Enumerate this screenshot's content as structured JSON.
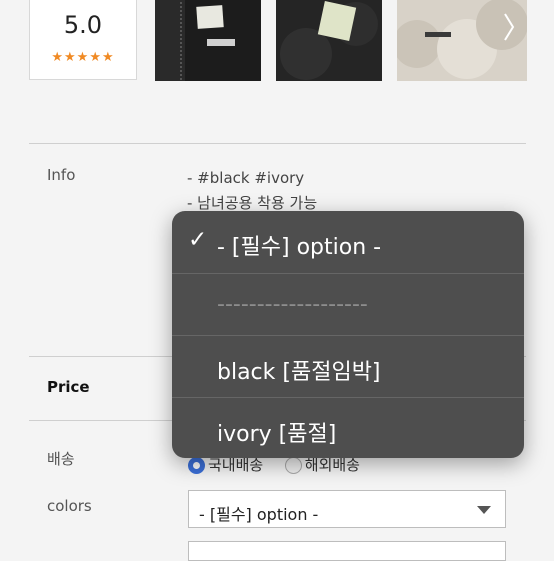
{
  "review": {
    "score": "5.0",
    "stars": "★★★★★"
  },
  "details": {
    "info_label": "Info",
    "info_lines": [
      "- #black #ivory",
      "- 남녀공용 착용 가능"
    ],
    "price_label": "Price",
    "shipping_label": "배송",
    "shipping_options": [
      "국내배송",
      "해외배송"
    ],
    "colors_label": "colors",
    "colors_select_value": "- [필수] option -"
  },
  "dropdown": {
    "options": [
      {
        "label": "- [필수] option -",
        "selected": true
      },
      {
        "label": "-------------------",
        "selected": false
      },
      {
        "label": "black [품절임박]",
        "selected": false
      },
      {
        "label": "ivory [품절]",
        "selected": false
      }
    ],
    "check_mark": "✓"
  },
  "colors": {
    "popup_bg": "#4e4e4e",
    "radio_accent": "#3b6fd8",
    "star": "#f08a24"
  }
}
